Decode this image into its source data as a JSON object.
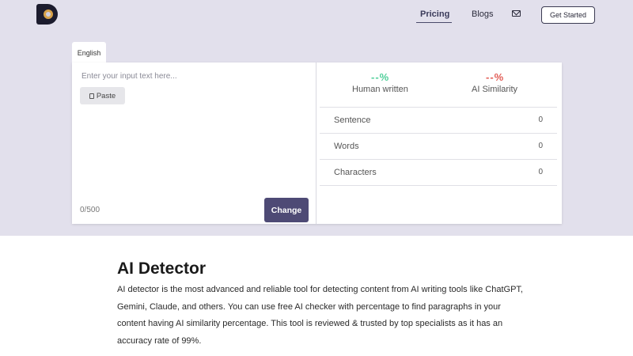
{
  "nav": {
    "pricing": "Pricing",
    "blogs": "Blogs",
    "get_started": "Get Started",
    "mail_icon": "mail-icon",
    "logo_icon": "logo"
  },
  "tabs": {
    "language": "English"
  },
  "editor": {
    "placeholder": "Enter your input text here...",
    "paste_label": "Paste",
    "paste_icon": "clipboard-icon",
    "counter": "0/500",
    "change_label": "Change"
  },
  "results": {
    "human_percent": "--%",
    "human_label": "Human written",
    "ai_percent": "--%",
    "ai_label": "AI Similarity",
    "stats": [
      {
        "label": "Sentence",
        "value": "0"
      },
      {
        "label": "Words",
        "value": "0"
      },
      {
        "label": "Characters",
        "value": "0"
      }
    ]
  },
  "article": {
    "title": "AI Detector",
    "body": "AI detector is the most advanced and reliable tool for detecting content from AI writing tools like ChatGPT, Gemini, Claude, and others. You can use free AI checker with percentage to find paragraphs in your content having AI similarity percentage. This tool is reviewed & trusted by top specialists as it has an accuracy rate of 99%."
  },
  "colors": {
    "hero_bg": "#e2e0ec",
    "primary_button": "#4e4a75",
    "human_green": "#4fcf9a",
    "ai_red": "#e25c55"
  }
}
